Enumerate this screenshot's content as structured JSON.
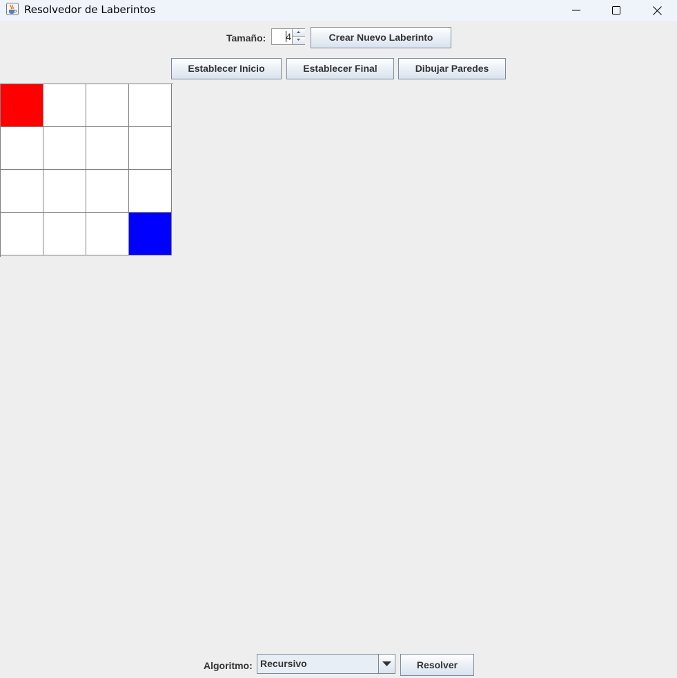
{
  "window": {
    "title": "Resolvedor de Laberintos"
  },
  "toolbar": {
    "size_label": "Tamaño:",
    "size_value": "4",
    "create_label": "Crear Nuevo Laberinto",
    "start_label": "Establecer Inicio",
    "end_label": "Establecer Final",
    "walls_label": "Dibujar Paredes"
  },
  "maze": {
    "size": 4,
    "cells": [
      [
        "start",
        "empty",
        "empty",
        "empty"
      ],
      [
        "empty",
        "empty",
        "empty",
        "empty"
      ],
      [
        "empty",
        "empty",
        "empty",
        "empty"
      ],
      [
        "empty",
        "empty",
        "empty",
        "end"
      ]
    ],
    "colors": {
      "start": "#ff0000",
      "end": "#0000ff",
      "empty": "#ffffff",
      "grid": "#808080"
    }
  },
  "bottom": {
    "algorithm_label": "Algoritmo:",
    "algorithm_selected": "Recursivo",
    "solve_label": "Resolver"
  },
  "icons": {
    "app": "java-cup-icon",
    "minimize": "minimize-icon",
    "maximize": "maximize-icon",
    "close": "close-icon",
    "spin_up": "chevron-up-icon",
    "spin_down": "chevron-down-icon",
    "combo": "triangle-down-icon"
  }
}
